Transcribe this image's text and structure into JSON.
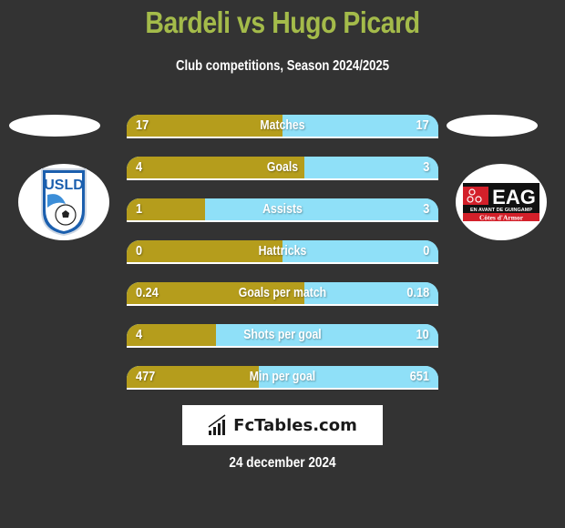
{
  "header": {
    "title": "Bardeli vs Hugo Picard",
    "subtitle": "Club competitions, Season 2024/2025"
  },
  "teams": {
    "left": {
      "crest_text": "USLD",
      "crest_icon": "usld-crest-icon"
    },
    "right": {
      "crest_text": "EAG",
      "crest_subtext": "EN AVANT DE GUINGAMP",
      "crest_subtext2": "Côtes d'Armor",
      "crest_icon": "eag-crest-icon"
    }
  },
  "colors": {
    "left_bar": "#b59d1c",
    "right_bar": "#8fe0f8",
    "title": "#a4bb4a",
    "background": "#333333"
  },
  "stats": [
    {
      "label": "Matches",
      "left": "17",
      "right": "17",
      "left_share": 0.5
    },
    {
      "label": "Goals",
      "left": "4",
      "right": "3",
      "left_share": 0.571
    },
    {
      "label": "Assists",
      "left": "1",
      "right": "3",
      "left_share": 0.25
    },
    {
      "label": "Hattricks",
      "left": "0",
      "right": "0",
      "left_share": 0.5
    },
    {
      "label": "Goals per match",
      "left": "0.24",
      "right": "0.18",
      "left_share": 0.571
    },
    {
      "label": "Shots per goal",
      "left": "4",
      "right": "10",
      "left_share": 0.286
    },
    {
      "label": "Min per goal",
      "left": "477",
      "right": "651",
      "left_share": 0.423
    }
  ],
  "brand": {
    "name": "FcTables.com",
    "icon": "bar-chart-icon"
  },
  "footer": {
    "date": "24 december 2024"
  }
}
